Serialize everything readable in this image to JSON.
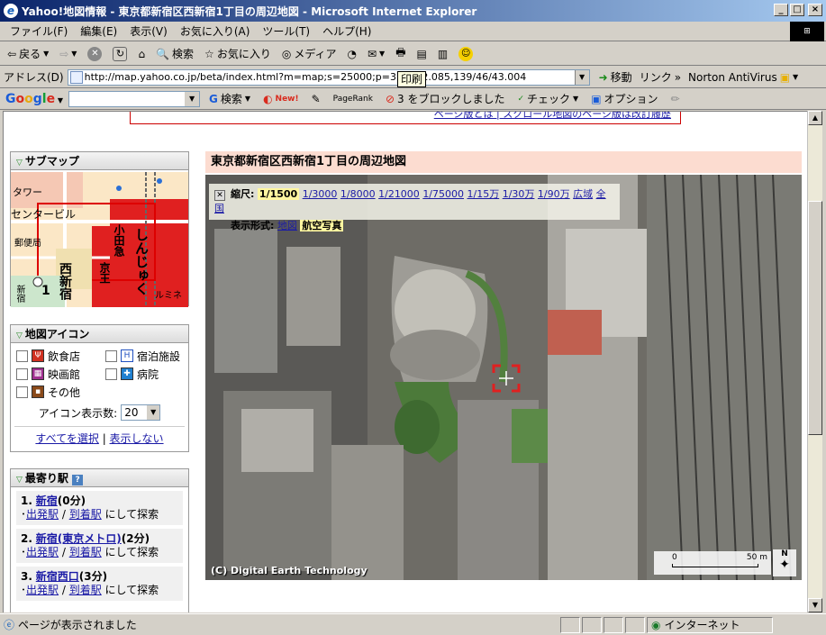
{
  "window": {
    "title": "Yahoo!地図情報 - 東京都新宿区西新宿1丁目の周辺地図 - Microsoft Internet Explorer",
    "min": "_",
    "max": "□",
    "close": "×"
  },
  "menu": [
    "ファイル(F)",
    "編集(E)",
    "表示(V)",
    "お気に入り(A)",
    "ツール(T)",
    "ヘルプ(H)"
  ],
  "toolbar": {
    "back": "戻る",
    "search": "検索",
    "favorites": "お気に入り",
    "media": "メディア"
  },
  "address": {
    "label": "アドレス(D)",
    "url": "http://map.yahoo.co.jp/beta/index.html?m=map;s=25000;p=35/40/2.085,139/46/43.004",
    "go": "移動",
    "links": "リンク",
    "antivirus": "Norton AntiVirus"
  },
  "tooltip": "印刷",
  "google": {
    "search_btn": "検索",
    "new_label": "New!",
    "pagerank": "PageRank",
    "blocked": "3 をブロックしました",
    "check": "チェック",
    "options": "オプション"
  },
  "top_links": "ページ版とは | スクロール地図のページ版は改訂履歴",
  "submap": {
    "title": "サブマップ",
    "labels": [
      "タワー",
      "センタービル",
      "小田急",
      "しんじゅく",
      "京王",
      "ルミネ",
      "西新宿",
      "1",
      "新宿",
      "郵便局"
    ]
  },
  "icons": {
    "title": "地図アイコン",
    "items": [
      "飲食店",
      "宿泊施設",
      "映画館",
      "病院",
      "その他"
    ],
    "count_label": "アイコン表示数:",
    "count_value": "20",
    "select_all": "すべてを選択",
    "hide": "表示しない"
  },
  "stations": {
    "title": "最寄り駅",
    "help": "?",
    "items": [
      {
        "num": "1.",
        "name": "新宿",
        "time": "(0分)"
      },
      {
        "num": "2.",
        "name": "新宿(東京メトロ)",
        "time": "(2分)"
      },
      {
        "num": "3.",
        "name": "新宿西口",
        "time": "(3分)"
      }
    ],
    "depart": "出発駅",
    "arrive": "到着駅",
    "suffix": "にして探索"
  },
  "map": {
    "heading": "東京都新宿区西新宿1丁目の周辺地図",
    "scale_label": "縮尺:",
    "scale_current": "1/1500",
    "scales": [
      "1/3000",
      "1/8000",
      "1/21000",
      "1/75000",
      "1/15万",
      "1/30万",
      "1/90万",
      "広域",
      "全国"
    ],
    "display_label": "表示形式:",
    "display_map": "地図",
    "display_aerial": "航空写真",
    "copyright": "(C) Digital Earth Technology",
    "scalebar_start": "0",
    "scalebar_end": "50 m",
    "north": "N"
  },
  "status": {
    "text": "ページが表示されました",
    "zone": "インターネット"
  }
}
